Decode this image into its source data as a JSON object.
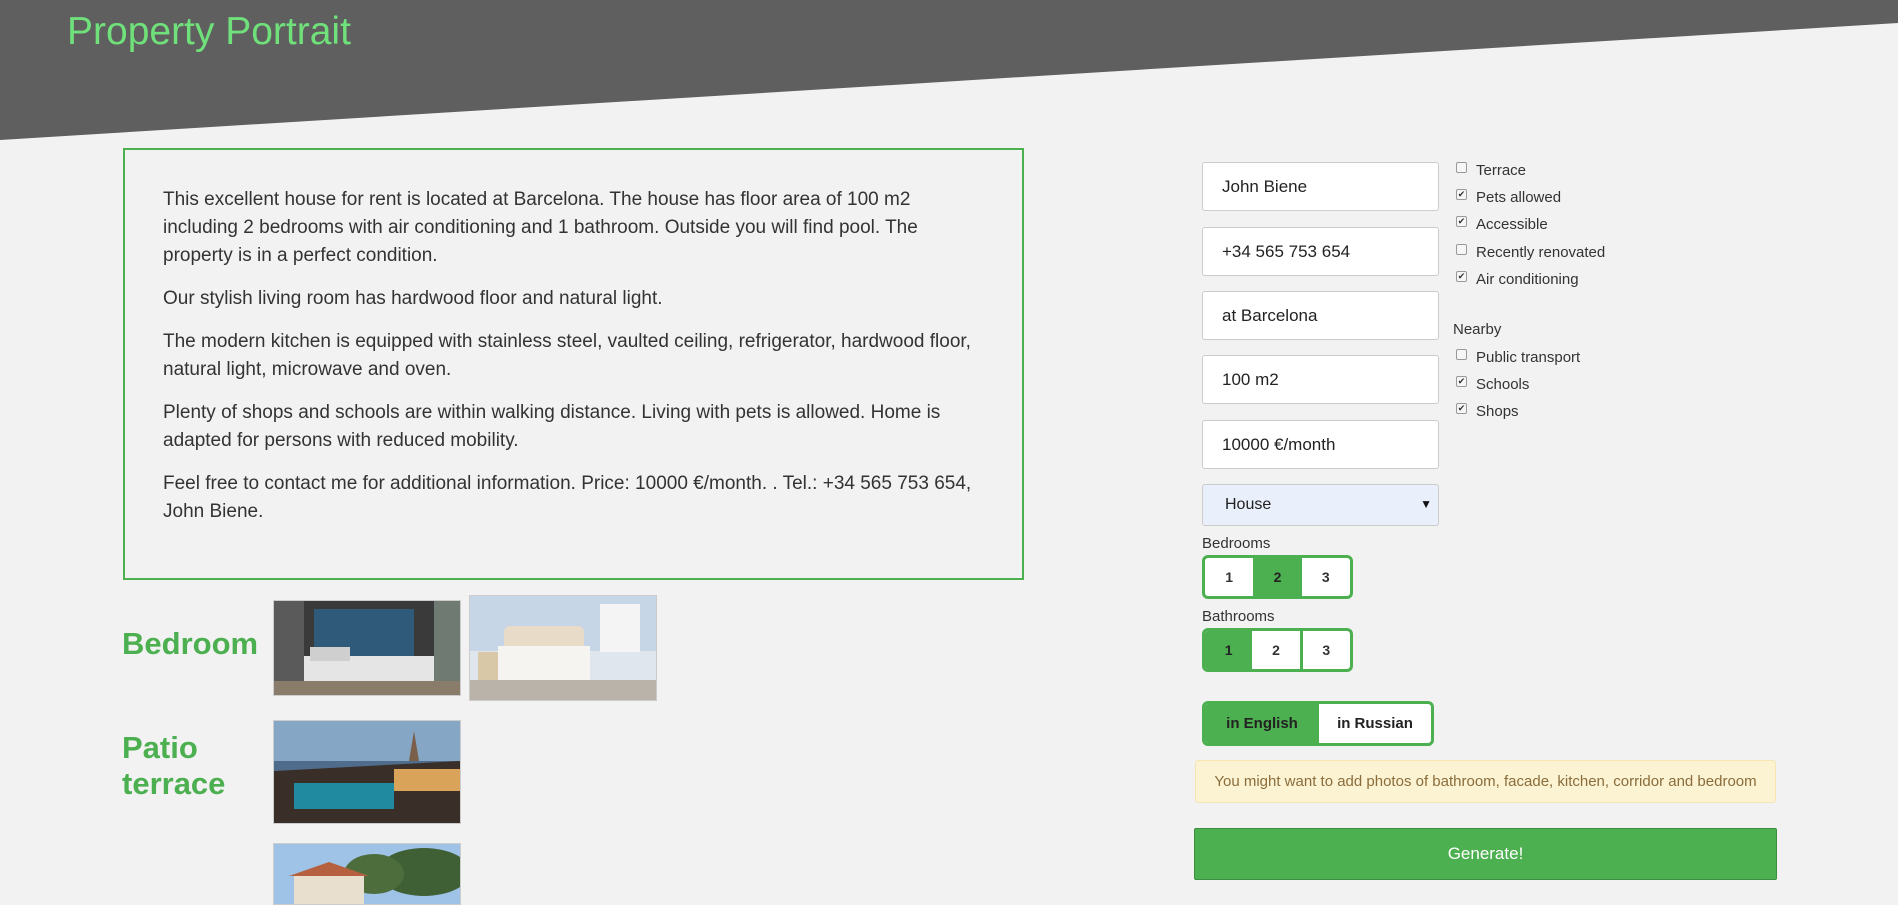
{
  "header": {
    "title": "Property Portrait"
  },
  "description": {
    "paragraphs": [
      "This excellent house for rent is located at Barcelona. The house has floor area of 100 m2 including 2 bedrooms with air conditioning and 1 bathroom. Outside you will find pool. The property is in a perfect condition.",
      "Our stylish living room has hardwood floor and natural light.",
      "The modern kitchen is equipped with stainless steel, vaulted ceiling, refrigerator, hardwood floor, natural light, microwave and oven.",
      "Plenty of shops and schools are within walking distance. Living with pets is allowed. Home is adapted for persons with reduced mobility.",
      "Feel free to contact me for additional information. Price: 10000 €/month. . Tel.: +34 565 753 654, John Biene."
    ]
  },
  "photos": {
    "bedroom_title": "Bedroom",
    "patio_title_line1": "Patio",
    "patio_title_line2": "terrace"
  },
  "form": {
    "name": "John Biene",
    "phone": "+34 565 753 654",
    "location": "at Barcelona",
    "area": "100 m2",
    "price": "10000 €/month",
    "property_type": "House",
    "bedrooms_label": "Bedrooms",
    "bedrooms_options": [
      "1",
      "2",
      "3"
    ],
    "bedrooms_selected": "2",
    "bathrooms_label": "Bathrooms",
    "bathrooms_options": [
      "1",
      "2",
      "3"
    ],
    "bathrooms_selected": "1",
    "lang_english": "in English",
    "lang_russian": "in Russian",
    "lang_selected": "in English"
  },
  "features": [
    {
      "label": "Terrace",
      "checked": false
    },
    {
      "label": "Pets allowed",
      "checked": true
    },
    {
      "label": "Accessible",
      "checked": true
    },
    {
      "label": "Recently renovated",
      "checked": false
    },
    {
      "label": "Air conditioning",
      "checked": true
    }
  ],
  "nearby": {
    "label": "Nearby",
    "items": [
      {
        "label": "Public transport",
        "checked": false
      },
      {
        "label": "Schools",
        "checked": true
      },
      {
        "label": "Shops",
        "checked": true
      }
    ]
  },
  "alert": {
    "text": "You might want to add photos of bathroom, facade, kitchen, corridor and bedroom"
  },
  "generate_label": "Generate!",
  "colors": {
    "accent": "#4caf50",
    "title": "#6fe07a",
    "header_bg": "#5f5f5f"
  }
}
